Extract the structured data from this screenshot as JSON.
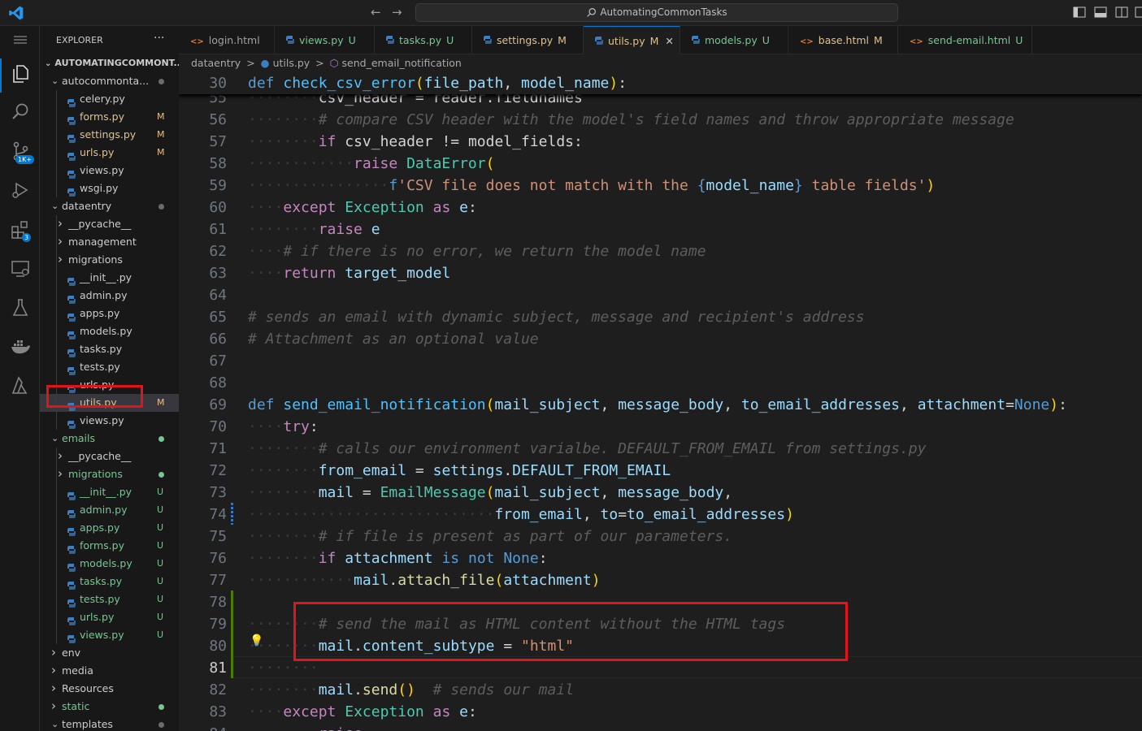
{
  "titlebar": {
    "search_text": "AutomatingCommonTasks",
    "back_arrow": "←",
    "forward_arrow": "→"
  },
  "activity": {
    "source_control_badge": "1K+",
    "extensions_badge": "3"
  },
  "sidebar": {
    "header": "EXPLORER",
    "more": "···",
    "section": "AUTOMATINGCOMMONT...",
    "items": [
      {
        "label": "autocommonta...",
        "type": "folder",
        "open": true,
        "depth": 0,
        "dot": "#6b6b6b"
      },
      {
        "label": "celery.py",
        "type": "py",
        "depth": 1,
        "status": ""
      },
      {
        "label": "forms.py",
        "type": "py",
        "depth": 1,
        "status": "M"
      },
      {
        "label": "settings.py",
        "type": "py",
        "depth": 1,
        "status": "M"
      },
      {
        "label": "urls.py",
        "type": "py",
        "depth": 1,
        "status": "M"
      },
      {
        "label": "views.py",
        "type": "py",
        "depth": 1,
        "status": ""
      },
      {
        "label": "wsgi.py",
        "type": "py",
        "depth": 1,
        "status": ""
      },
      {
        "label": "dataentry",
        "type": "folder",
        "open": true,
        "depth": 0,
        "dot": "#6b6b6b"
      },
      {
        "label": "__pycache__",
        "type": "folder",
        "open": false,
        "depth": 1
      },
      {
        "label": "management",
        "type": "folder",
        "open": false,
        "depth": 1
      },
      {
        "label": "migrations",
        "type": "folder",
        "open": false,
        "depth": 1
      },
      {
        "label": "__init__.py",
        "type": "py",
        "depth": 1,
        "status": ""
      },
      {
        "label": "admin.py",
        "type": "py",
        "depth": 1,
        "status": ""
      },
      {
        "label": "apps.py",
        "type": "py",
        "depth": 1,
        "status": ""
      },
      {
        "label": "models.py",
        "type": "py",
        "depth": 1,
        "status": ""
      },
      {
        "label": "tasks.py",
        "type": "py",
        "depth": 1,
        "status": ""
      },
      {
        "label": "tests.py",
        "type": "py",
        "depth": 1,
        "status": ""
      },
      {
        "label": "urls.py",
        "type": "py",
        "depth": 1,
        "status": ""
      },
      {
        "label": "utils.py",
        "type": "py",
        "depth": 1,
        "status": "M",
        "selected": true
      },
      {
        "label": "views.py",
        "type": "py",
        "depth": 1,
        "status": ""
      },
      {
        "label": "emails",
        "type": "folder",
        "open": true,
        "depth": 0,
        "dot": "#73c991",
        "color": "#73c991"
      },
      {
        "label": "__pycache__",
        "type": "folder",
        "open": false,
        "depth": 1
      },
      {
        "label": "migrations",
        "type": "folder",
        "open": false,
        "depth": 1,
        "dot": "#73c991",
        "color": "#73c991"
      },
      {
        "label": "__init__.py",
        "type": "py",
        "depth": 1,
        "status": "U",
        "color": "#73c991"
      },
      {
        "label": "admin.py",
        "type": "py",
        "depth": 1,
        "status": "U",
        "color": "#73c991"
      },
      {
        "label": "apps.py",
        "type": "py",
        "depth": 1,
        "status": "U",
        "color": "#73c991"
      },
      {
        "label": "forms.py",
        "type": "py",
        "depth": 1,
        "status": "U",
        "color": "#73c991"
      },
      {
        "label": "models.py",
        "type": "py",
        "depth": 1,
        "status": "U",
        "color": "#73c991"
      },
      {
        "label": "tasks.py",
        "type": "py",
        "depth": 1,
        "status": "U",
        "color": "#73c991"
      },
      {
        "label": "tests.py",
        "type": "py",
        "depth": 1,
        "status": "U",
        "color": "#73c991"
      },
      {
        "label": "urls.py",
        "type": "py",
        "depth": 1,
        "status": "U",
        "color": "#73c991"
      },
      {
        "label": "views.py",
        "type": "py",
        "depth": 1,
        "status": "U",
        "color": "#73c991"
      },
      {
        "label": "env",
        "type": "folder",
        "open": false,
        "depth": 0
      },
      {
        "label": "media",
        "type": "folder",
        "open": false,
        "depth": 0
      },
      {
        "label": "Resources",
        "type": "folder",
        "open": false,
        "depth": 0
      },
      {
        "label": "static",
        "type": "folder",
        "open": false,
        "depth": 0,
        "dot": "#73c991",
        "color": "#73c991"
      },
      {
        "label": "templates",
        "type": "folder",
        "open": true,
        "depth": 0,
        "dot": "#6b6b6b"
      }
    ]
  },
  "tabs": [
    {
      "label": "login.html",
      "status": "",
      "icon": "html",
      "color": "#a0a0a0"
    },
    {
      "label": "views.py",
      "status": "U",
      "icon": "py",
      "color": "#73c991"
    },
    {
      "label": "tasks.py",
      "status": "U",
      "icon": "py",
      "color": "#73c991"
    },
    {
      "label": "settings.py",
      "status": "M",
      "icon": "py",
      "color": "#e2c08d"
    },
    {
      "label": "utils.py",
      "status": "M",
      "icon": "py",
      "color": "#e2c08d",
      "active": true,
      "close": "✕"
    },
    {
      "label": "models.py",
      "status": "U",
      "icon": "py",
      "color": "#73c991"
    },
    {
      "label": "base.html",
      "status": "M",
      "icon": "html",
      "color": "#e2c08d"
    },
    {
      "label": "send-email.html",
      "status": "U",
      "icon": "html",
      "color": "#73c991"
    }
  ],
  "breadcrumb": {
    "folder": "dataentry",
    "file": "utils.py",
    "symbol": "send_email_notification",
    "sep": ">"
  },
  "sticky_line": {
    "n": "30",
    "tokens": [
      [
        "df",
        "def"
      ],
      [
        "pn",
        " "
      ],
      [
        "fnd",
        "check_csv_error"
      ],
      [
        "br1",
        "("
      ],
      [
        "pa",
        "file_path"
      ],
      [
        "pn",
        ", "
      ],
      [
        "pa",
        "model_name"
      ],
      [
        "br1",
        ")"
      ],
      [
        "pn",
        ":"
      ]
    ]
  },
  "code_lines": [
    {
      "n": "55",
      "tokens": [
        [
          "ws",
          "········"
        ],
        [
          "pn",
          "csv_header = reader.fieldnames"
        ]
      ]
    },
    {
      "n": "56",
      "tokens": [
        [
          "ws",
          "········"
        ],
        [
          "cmg",
          "# compare CSV header with the model's field names and throw appropriate message"
        ]
      ]
    },
    {
      "n": "57",
      "tokens": [
        [
          "ws",
          "········"
        ],
        [
          "kw",
          "if"
        ],
        [
          "pn",
          " csv_header "
        ],
        [
          "op",
          "!="
        ],
        [
          "pn",
          " model_fields:"
        ]
      ]
    },
    {
      "n": "58",
      "tokens": [
        [
          "ws",
          "············"
        ],
        [
          "kw",
          "raise"
        ],
        [
          "pn",
          " "
        ],
        [
          "cl",
          "DataError"
        ],
        [
          "br1",
          "("
        ]
      ]
    },
    {
      "n": "59",
      "tokens": [
        [
          "ws",
          "················"
        ],
        [
          "cst",
          "f"
        ],
        [
          "fs",
          "'CSV file does not match with the "
        ],
        [
          "cst",
          "{"
        ],
        [
          "pa",
          "model_name"
        ],
        [
          "cst",
          "}"
        ],
        [
          "fs",
          " table fields'"
        ],
        [
          "br1",
          ")"
        ]
      ]
    },
    {
      "n": "60",
      "tokens": [
        [
          "ws",
          "····"
        ],
        [
          "kw",
          "except"
        ],
        [
          "pn",
          " "
        ],
        [
          "cl",
          "Exception"
        ],
        [
          "pn",
          " "
        ],
        [
          "kw",
          "as"
        ],
        [
          "pn",
          " "
        ],
        [
          "pa",
          "e"
        ],
        [
          "pn",
          ":"
        ]
      ]
    },
    {
      "n": "61",
      "tokens": [
        [
          "ws",
          "········"
        ],
        [
          "kw",
          "raise"
        ],
        [
          "pn",
          " "
        ],
        [
          "pa",
          "e"
        ]
      ]
    },
    {
      "n": "62",
      "tokens": [
        [
          "ws",
          "····"
        ],
        [
          "cmg",
          "# if there is no error, we return the model name"
        ]
      ]
    },
    {
      "n": "63",
      "tokens": [
        [
          "ws",
          "····"
        ],
        [
          "kw",
          "return"
        ],
        [
          "pn",
          " "
        ],
        [
          "pa",
          "target_model"
        ]
      ]
    },
    {
      "n": "64",
      "tokens": []
    },
    {
      "n": "65",
      "tokens": [
        [
          "cmg",
          "# sends an email with dynamic subject, message and recipient's address"
        ]
      ]
    },
    {
      "n": "66",
      "tokens": [
        [
          "cmg",
          "# Attachment as an optional value"
        ]
      ]
    },
    {
      "n": "67",
      "tokens": []
    },
    {
      "n": "68",
      "tokens": []
    },
    {
      "n": "69",
      "tokens": [
        [
          "df",
          "def"
        ],
        [
          "pn",
          " "
        ],
        [
          "fnd",
          "send_email_notification"
        ],
        [
          "br1",
          "("
        ],
        [
          "pa",
          "mail_subject"
        ],
        [
          "pn",
          ", "
        ],
        [
          "pa",
          "message_body"
        ],
        [
          "pn",
          ", "
        ],
        [
          "pa",
          "to_email_addresses"
        ],
        [
          "pn",
          ", "
        ],
        [
          "pa",
          "attachment"
        ],
        [
          "op",
          "="
        ],
        [
          "cst",
          "None"
        ],
        [
          "br1",
          ")"
        ],
        [
          "pn",
          ":"
        ]
      ]
    },
    {
      "n": "70",
      "tokens": [
        [
          "ws",
          "····"
        ],
        [
          "kw",
          "try"
        ],
        [
          "pn",
          ":"
        ]
      ]
    },
    {
      "n": "71",
      "tokens": [
        [
          "ws",
          "········"
        ],
        [
          "cmg",
          "# calls our environment varialbe. DEFAULT_FROM_EMAIL from settings.py"
        ]
      ]
    },
    {
      "n": "72",
      "tokens": [
        [
          "ws",
          "········"
        ],
        [
          "pa",
          "from_email"
        ],
        [
          "pn",
          " "
        ],
        [
          "op",
          "="
        ],
        [
          "pn",
          " "
        ],
        [
          "pa",
          "settings"
        ],
        [
          "pn",
          "."
        ],
        [
          "pa",
          "DEFAULT_FROM_EMAIL"
        ]
      ]
    },
    {
      "n": "73",
      "tokens": [
        [
          "ws",
          "········"
        ],
        [
          "pa",
          "mail"
        ],
        [
          "pn",
          " "
        ],
        [
          "op",
          "="
        ],
        [
          "pn",
          " "
        ],
        [
          "cl",
          "EmailMessage"
        ],
        [
          "br1",
          "("
        ],
        [
          "pa",
          "mail_subject"
        ],
        [
          "pn",
          ", "
        ],
        [
          "pa",
          "message_body"
        ],
        [
          "pn",
          ","
        ]
      ]
    },
    {
      "n": "74",
      "tokens": [
        [
          "ws",
          "····························"
        ],
        [
          "pa",
          "from_email"
        ],
        [
          "pn",
          ", "
        ],
        [
          "pa",
          "to"
        ],
        [
          "op",
          "="
        ],
        [
          "pa",
          "to_email_addresses"
        ],
        [
          "br1",
          ")"
        ]
      ]
    },
    {
      "n": "75",
      "tokens": [
        [
          "ws",
          "········"
        ],
        [
          "cmg",
          "# if file is present as part of our parameters."
        ]
      ]
    },
    {
      "n": "76",
      "tokens": [
        [
          "ws",
          "········"
        ],
        [
          "kw",
          "if"
        ],
        [
          "pn",
          " "
        ],
        [
          "pa",
          "attachment"
        ],
        [
          "pn",
          " "
        ],
        [
          "df",
          "is"
        ],
        [
          "pn",
          " "
        ],
        [
          "df",
          "not"
        ],
        [
          "pn",
          " "
        ],
        [
          "cst",
          "None"
        ],
        [
          "pn",
          ":"
        ]
      ]
    },
    {
      "n": "77",
      "tokens": [
        [
          "ws",
          "············"
        ],
        [
          "pa",
          "mail"
        ],
        [
          "pn",
          "."
        ],
        [
          "fn",
          "attach_file"
        ],
        [
          "br1",
          "("
        ],
        [
          "pa",
          "attachment"
        ],
        [
          "br1",
          ")"
        ]
      ]
    },
    {
      "n": "78",
      "tokens": []
    },
    {
      "n": "79",
      "tokens": [
        [
          "ws",
          "········"
        ],
        [
          "cmg",
          "# send the mail as HTML content without the HTML tags"
        ]
      ]
    },
    {
      "n": "80",
      "tokens": [
        [
          "ws",
          "········"
        ],
        [
          "pa",
          "mail"
        ],
        [
          "pn",
          "."
        ],
        [
          "pa",
          "content_subtype"
        ],
        [
          "pn",
          " "
        ],
        [
          "op",
          "="
        ],
        [
          "pn",
          " "
        ],
        [
          "st2",
          "\"html\""
        ]
      ]
    },
    {
      "n": "81",
      "tokens": [
        [
          "ws",
          "········"
        ]
      ],
      "current": true
    },
    {
      "n": "82",
      "tokens": [
        [
          "ws",
          "········"
        ],
        [
          "pa",
          "mail"
        ],
        [
          "pn",
          "."
        ],
        [
          "fn",
          "send"
        ],
        [
          "br1",
          "()"
        ],
        [
          "pn",
          "  "
        ],
        [
          "cmg",
          "# sends our mail"
        ]
      ]
    },
    {
      "n": "83",
      "tokens": [
        [
          "ws",
          "····"
        ],
        [
          "kw",
          "except"
        ],
        [
          "pn",
          " "
        ],
        [
          "cl",
          "Exception"
        ],
        [
          "pn",
          " "
        ],
        [
          "kw",
          "as"
        ],
        [
          "pn",
          " "
        ],
        [
          "pa",
          "e"
        ],
        [
          "pn",
          ":"
        ]
      ]
    },
    {
      "n": "84",
      "tokens": [
        [
          "ws",
          "········"
        ],
        [
          "kw",
          "raise"
        ]
      ]
    }
  ],
  "colors": {
    "accent": "#0078d4",
    "modified": "#e2c08d",
    "untracked": "#73c991",
    "highlight_box": "#e2141b"
  }
}
